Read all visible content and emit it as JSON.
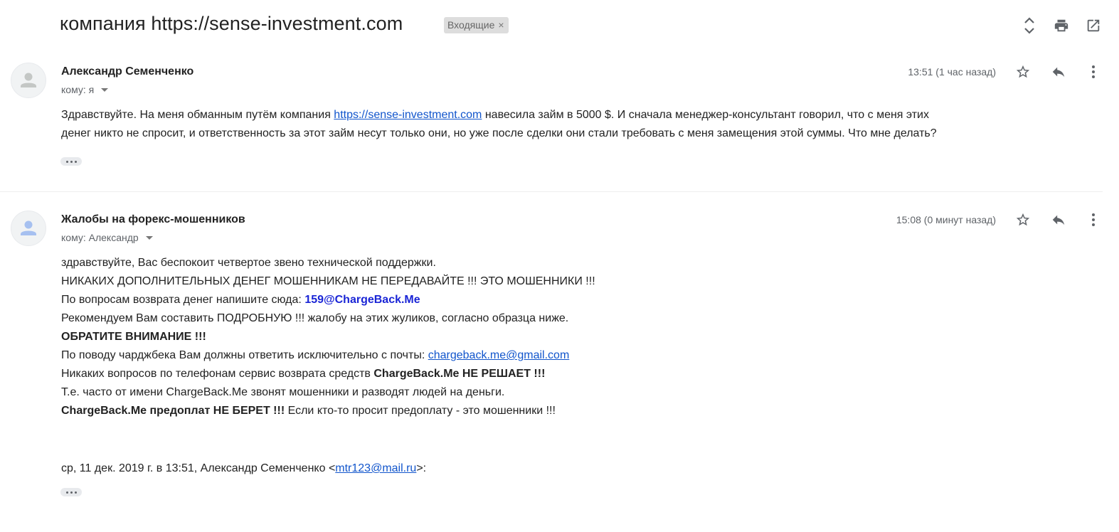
{
  "thread": {
    "subject": "компания https://sense-investment.com",
    "label": "Входящие",
    "label_close": "×",
    "icons": [
      "expand-collapse-icon",
      "print-icon",
      "open-new-window-icon"
    ]
  },
  "messages": [
    {
      "sender": "Александр Семенченко",
      "to": "кому: я",
      "time": "13:51 (1 час назад)",
      "body": {
        "line1_pre": "Здравствуйте. На меня обманным путём компания ",
        "line1_link": "https://sense-investment.com",
        "line1_post": " навесила займ в 5000 $. И сначала менеджер-консультант говорил, что с меня этих",
        "line2": "денег никто не спросит, и ответственность за этот займ несут только они, но уже после сделки они стали требовать с меня замещения этой суммы. Что мне делать?"
      }
    },
    {
      "sender": "Жалобы на форекс-мошенников",
      "to": "кому: Александр",
      "time": "15:08 (0 минут назад)",
      "body": {
        "l1": "здравствуйте, Вас беспокоит четвертое звено технической поддержки.",
        "l2": "НИКАКИХ ДОПОЛНИТЕЛЬНЫХ ДЕНЕГ МОШЕННИКАМ НЕ ПЕРЕДАВАЙТЕ !!! ЭТО МОШЕННИКИ !!!",
        "l3_pre": "По вопросам возврата денег напишите сюда: ",
        "l3_email": "159@ChargeBack.Me",
        "l4": "Рекомендуем Вам составить ПОДРОБНУЮ !!! жалобу на этих жуликов, согласно образца ниже.",
        "l5": "ОБРАТИТЕ ВНИМАНИЕ !!!",
        "l6_pre": "По поводу чарджбека Вам должны ответить исключительно с почты: ",
        "l6_email": "chargeback.me@gmail.com",
        "l7_pre": "Никаких вопросов по телефонам сервис возврата средств ",
        "l7_bold": "ChargeBack.Me НЕ РЕШАЕТ !!!",
        "l8": "Т.е. часто от имени ChargeBack.Me звонят мошенники и разводят людей на деньги.",
        "l9_bold": "ChargeBack.Me предоплат НЕ БЕРЕТ !!!",
        "l9_post": " Если кто-то просит предоплату - это мошенники !!!",
        "quote_pre": "ср, 11 дек. 2019 г. в 13:51, Александр Семенченко <",
        "quote_email": "mtr123@mail.ru",
        "quote_post": ">:"
      }
    }
  ],
  "colors": {
    "link": "#1155cc",
    "bold_email": "#1a25d6",
    "label_bg": "#dddddd",
    "muted": "#5f6368"
  }
}
